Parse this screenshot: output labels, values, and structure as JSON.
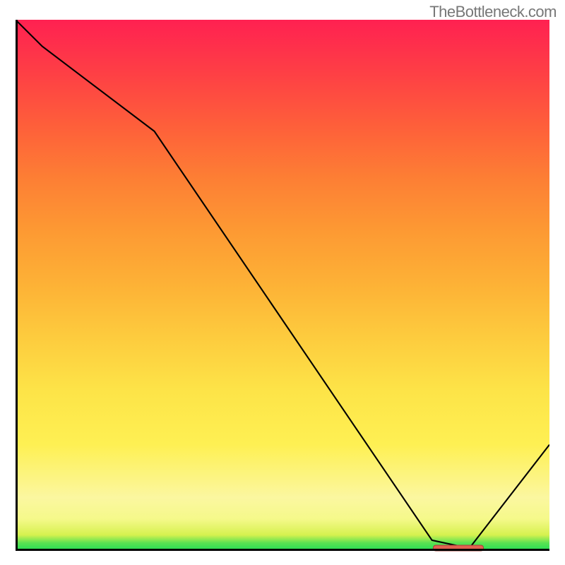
{
  "watermark": "TheBottleneck.com",
  "colors": {
    "curve": "#000000",
    "marker_fill": "#e06150",
    "marker_border": "#a73f38"
  },
  "chart_data": {
    "type": "line",
    "title": "",
    "xlabel": "",
    "ylabel": "",
    "xlim": [
      0,
      100
    ],
    "ylim": [
      0,
      100
    ],
    "series": [
      {
        "name": "curve",
        "x": [
          0,
          5,
          26,
          78,
          85,
          100
        ],
        "values": [
          100,
          95,
          79,
          2,
          0.5,
          20
        ]
      }
    ],
    "marker": {
      "x": 83,
      "y": 0.5
    },
    "gradient_scale": [
      {
        "pos": 0,
        "color": "#22dd55"
      },
      {
        "pos": 6,
        "color": "#f5f98a"
      },
      {
        "pos": 20,
        "color": "#fef053"
      },
      {
        "pos": 50,
        "color": "#fdb236"
      },
      {
        "pos": 80,
        "color": "#fe5f3a"
      },
      {
        "pos": 100,
        "color": "#ff2151"
      }
    ]
  }
}
